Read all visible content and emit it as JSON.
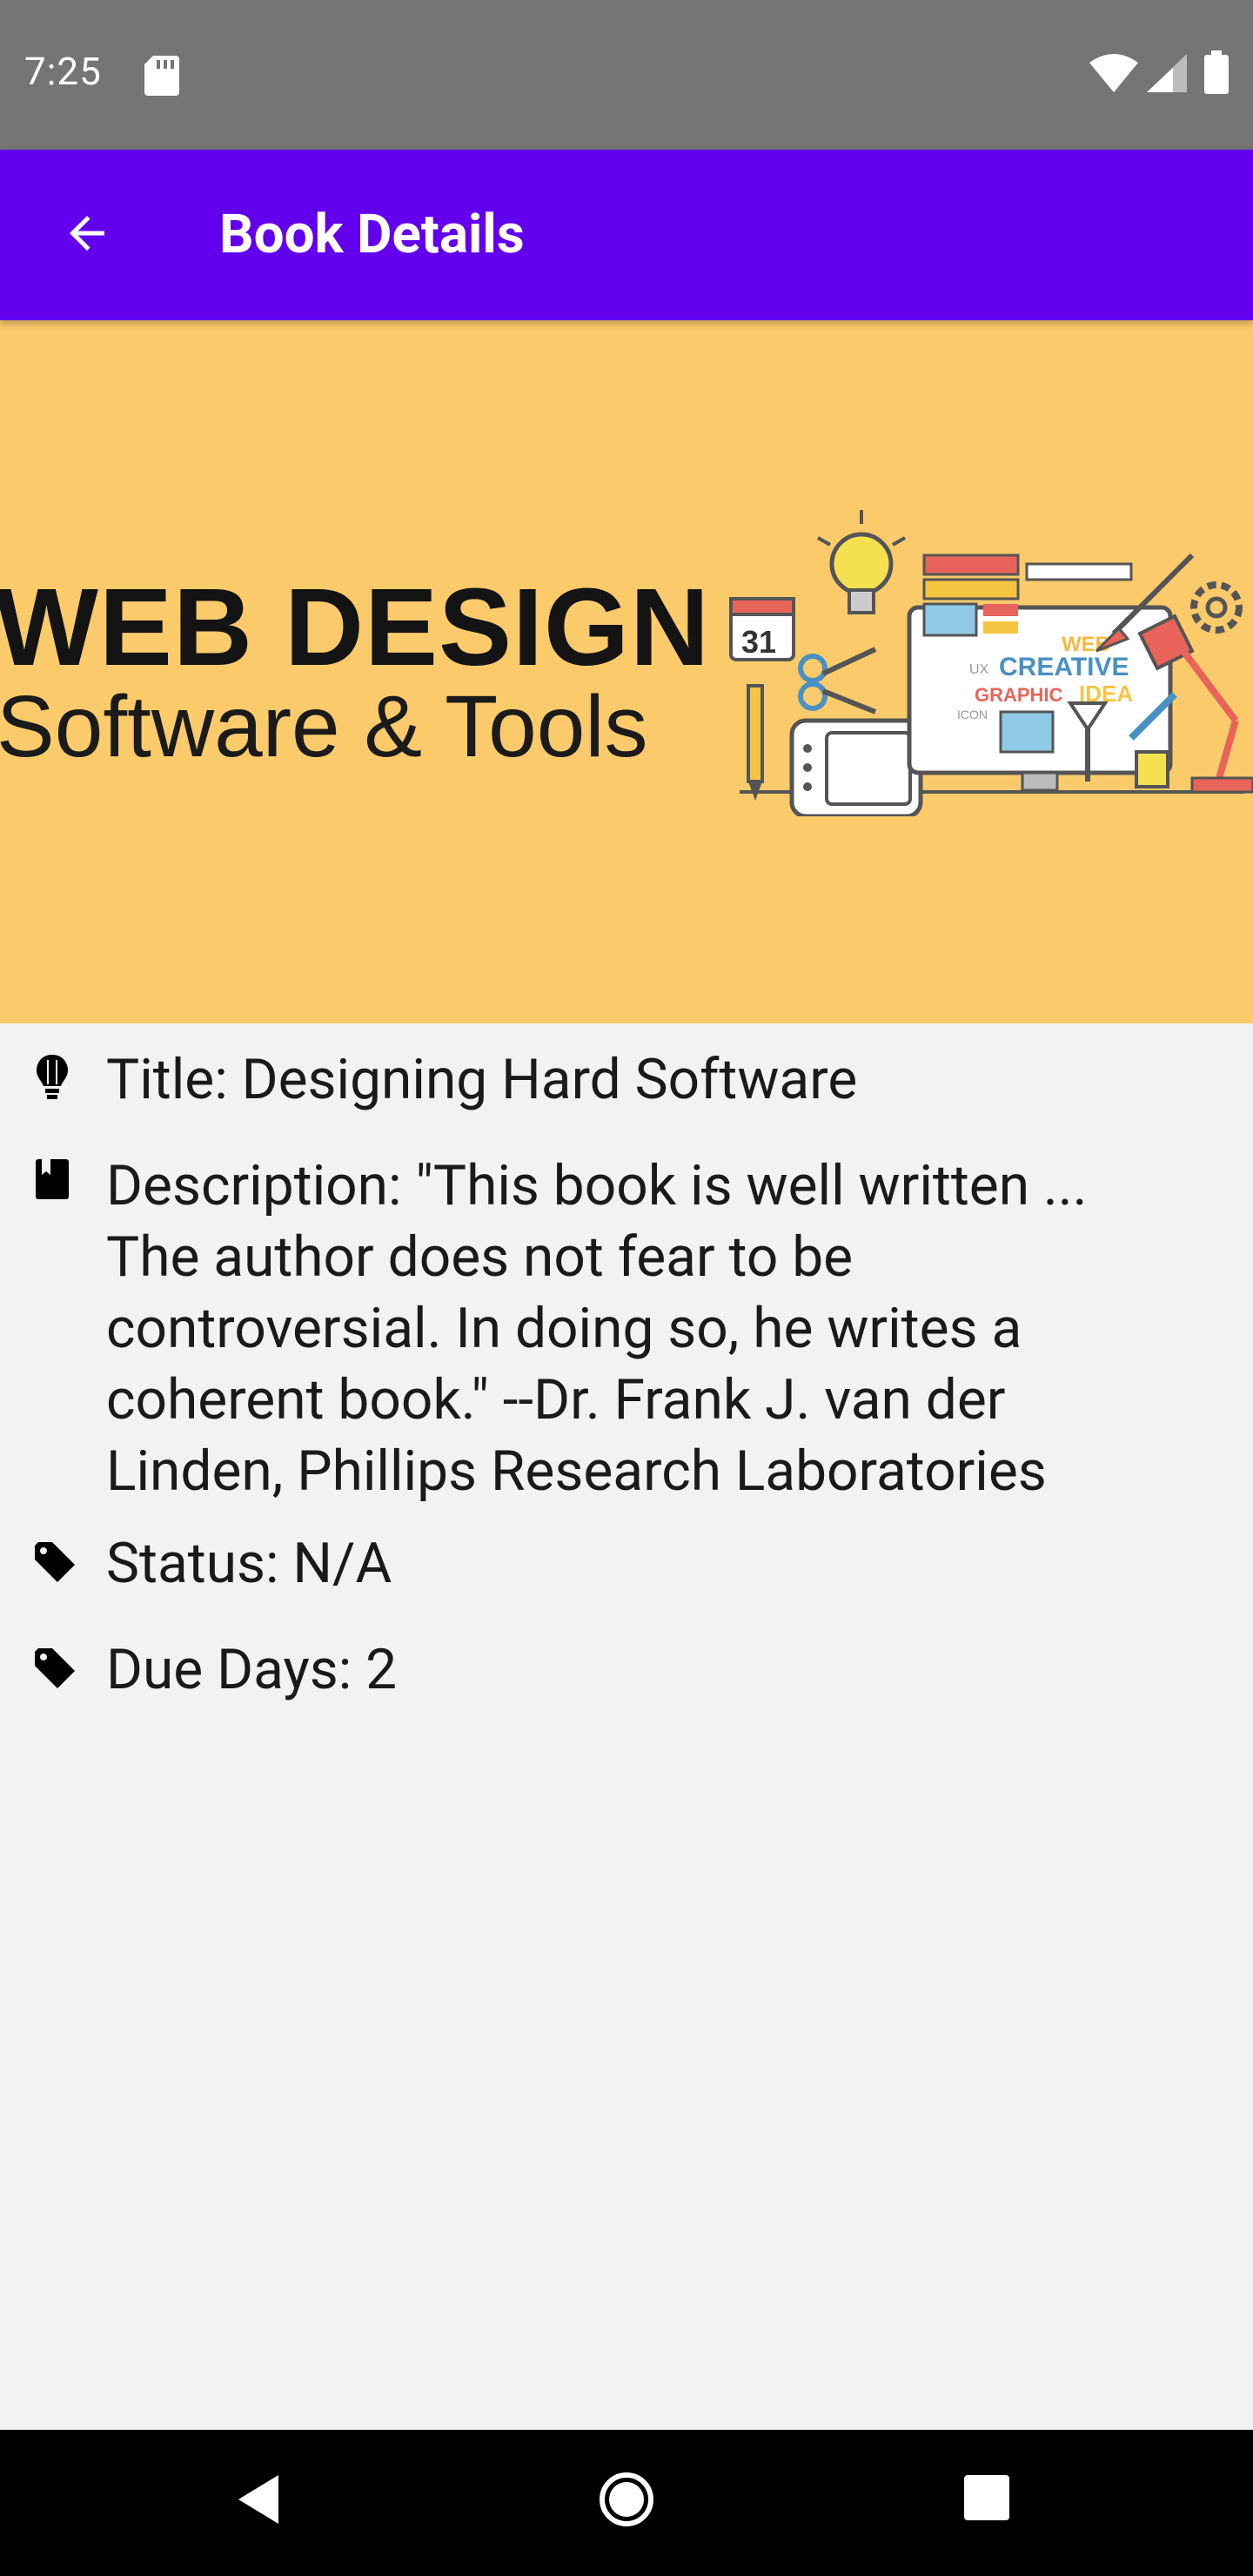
{
  "status_bar": {
    "time": "7:25"
  },
  "app_bar": {
    "title": "Book Details"
  },
  "banner": {
    "heading": "WEB DESIGN",
    "subheading": "Software & Tools",
    "art_words": [
      "WEB",
      "CREATIVE",
      "GRAPHIC",
      "IDEA",
      "UX",
      "ICON",
      "31"
    ],
    "background_color": "#fbcb6b"
  },
  "details": {
    "title": "Title: Designing Hard Software",
    "description": "Description: \"This book is well written ... The author does not fear to be controversial. In doing so, he writes a coherent book.\" --Dr. Frank J. van der Linden, Phillips Research Laboratories",
    "status": "Status: N/A",
    "due_days": "Due Days: 2"
  },
  "icons": {
    "title": "lightbulb-icon",
    "description": "book-icon",
    "status": "tag-icon",
    "due_days": "tag-icon"
  },
  "colors": {
    "app_bar": "#6200ee",
    "status_bar": "#757575",
    "page_background": "#f2f2f2"
  }
}
